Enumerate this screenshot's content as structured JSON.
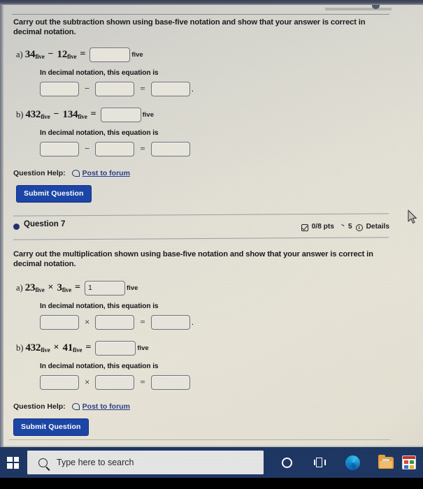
{
  "questions": [
    {
      "id": "q6",
      "prompt": "Carry out the subtraction shown using base-five notation and show that your answer is correct in decimal notation.",
      "parts": [
        {
          "label": "a)",
          "operand1": "34",
          "operand1_sub": "five",
          "operator": "−",
          "operand2": "12",
          "operand2_sub": "five",
          "equals": "=",
          "answer_value": "",
          "base_tag": "five",
          "decimal_label": "In decimal notation, this equation is",
          "decimal_operator": "−",
          "decimal_equals": "=",
          "decimal_values": [
            "",
            "",
            ""
          ],
          "trailing_period": "."
        },
        {
          "label": "b)",
          "operand1": "432",
          "operand1_sub": "five",
          "operator": "−",
          "operand2": "134",
          "operand2_sub": "five",
          "equals": "=",
          "answer_value": "",
          "base_tag": "five",
          "decimal_label": "In decimal notation, this equation is",
          "decimal_operator": "−",
          "decimal_equals": "=",
          "decimal_values": [
            "",
            "",
            ""
          ],
          "trailing_period": ""
        }
      ],
      "help_label": "Question Help:",
      "forum_link": "Post to forum",
      "submit_label": "Submit Question"
    },
    {
      "id": "q7",
      "header": {
        "title": "Question 7",
        "points": "0/8 pts",
        "attempts": "5",
        "details": "Details"
      },
      "prompt": "Carry out the multiplication shown using base-five notation and show that your answer is correct in decimal notation.",
      "parts": [
        {
          "label": "a)",
          "operand1": "23",
          "operand1_sub": "five",
          "operator": "×",
          "operand2": "3",
          "operand2_sub": "five",
          "equals": "=",
          "answer_value": "1",
          "base_tag": "five",
          "decimal_label": "In decimal notation, this equation is",
          "decimal_operator": "×",
          "decimal_equals": "=",
          "decimal_values": [
            "",
            "",
            ""
          ],
          "trailing_period": "."
        },
        {
          "label": "b)",
          "operand1": "432",
          "operand1_sub": "five",
          "operator": "×",
          "operand2": "41",
          "operand2_sub": "five",
          "equals": "=",
          "answer_value": "",
          "base_tag": "five",
          "decimal_label": "In decimal notation, this equation is",
          "decimal_operator": "×",
          "decimal_equals": "=",
          "decimal_values": [
            "",
            "",
            ""
          ],
          "trailing_period": ""
        }
      ],
      "help_label": "Question Help:",
      "forum_link": "Post to forum",
      "submit_label": "Submit Question"
    }
  ],
  "taskbar": {
    "search_placeholder": "Type here to search",
    "icons": [
      "windows-start-icon",
      "search-icon",
      "cortana-icon",
      "task-view-icon",
      "microsoft-edge-icon",
      "file-explorer-icon",
      "office-app-icon"
    ]
  },
  "colors": {
    "accent_button": "#1c47a8",
    "link": "#2b3f8c",
    "taskbar": "#1f3864",
    "bullet": "#29306d",
    "page_bg": "#e4e1d3"
  }
}
